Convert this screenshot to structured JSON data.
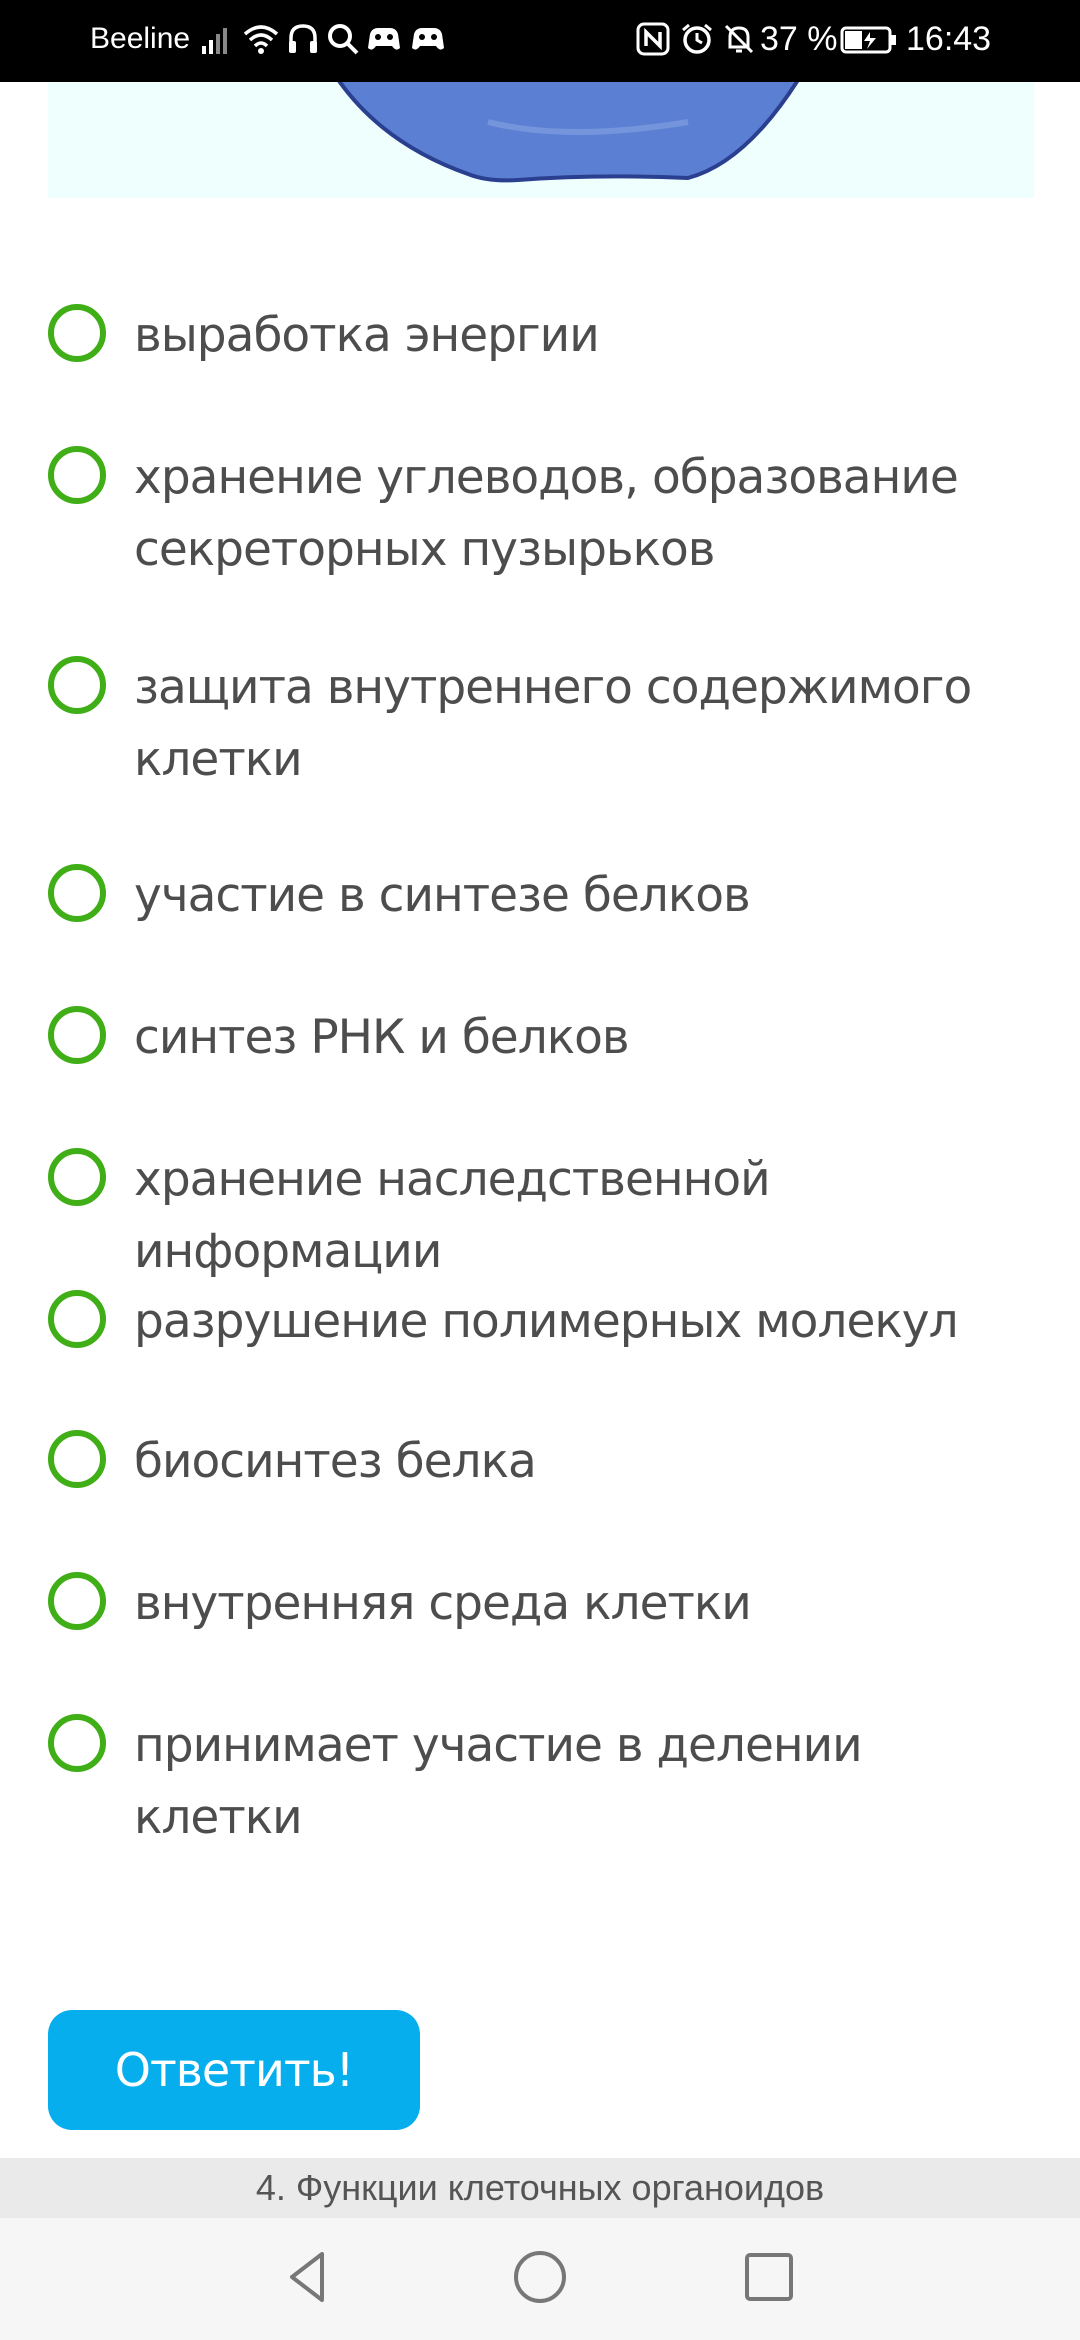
{
  "status_bar": {
    "carrier": "Beeline",
    "battery_percent": "37 %",
    "time": "16:43",
    "icons": [
      "signal-icon",
      "wifi-icon",
      "headphones-icon",
      "search-icon",
      "gamepad-icon",
      "gamepad-icon",
      "nfc-icon",
      "alarm-icon",
      "bell-off-icon",
      "battery-icon"
    ]
  },
  "question": {
    "options": [
      {
        "label": "выработка энергии"
      },
      {
        "label": "хранение углеводов, образование секреторных пузырьков"
      },
      {
        "label": "защита внутреннего содержимого клетки"
      },
      {
        "label": "участие в синтезе белков"
      },
      {
        "label": "синтез РНК и белков"
      },
      {
        "label": "хранение наследственной информации"
      },
      {
        "label": "разрушение полимерных молекул"
      },
      {
        "label": "биосинтез белка"
      },
      {
        "label": "внутренняя среда клетки"
      },
      {
        "label": "принимает участие в делении клетки"
      }
    ],
    "submit_label": "Ответить!"
  },
  "footer": {
    "title": "4. Функции клеточных органоидов"
  },
  "colors": {
    "radio_border": "#3fae17",
    "button_bg": "#06aeed",
    "status_bar_bg": "#000000"
  }
}
